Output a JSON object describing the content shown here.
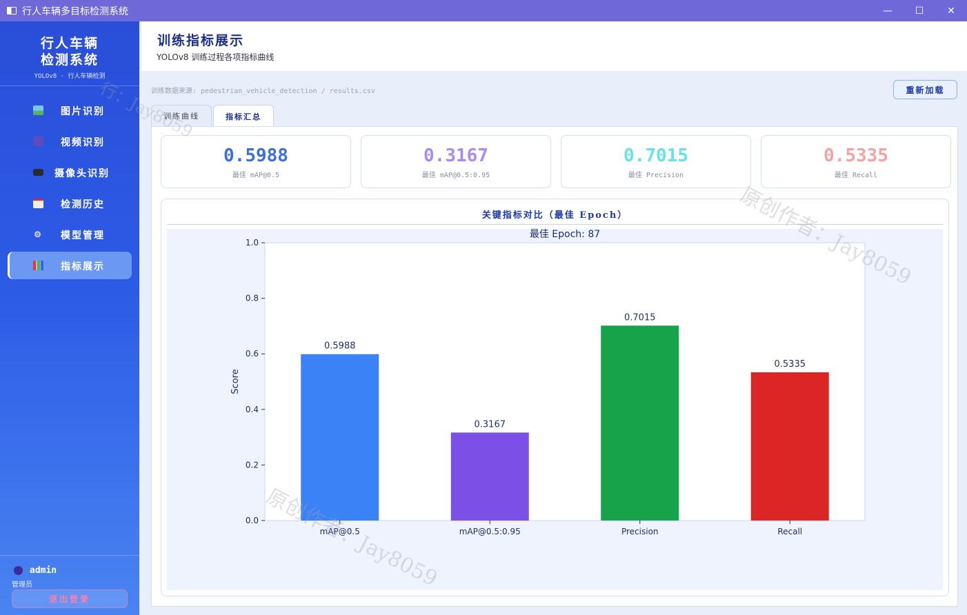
{
  "window": {
    "title": "行人车辆多目标检测系统",
    "minimize": "—",
    "maximize": "☐",
    "close": "✕"
  },
  "sidebar": {
    "brand_line1": "行人车辆",
    "brand_line2": "检测系统",
    "brand_sub": "YOLOv8 · 行人车辆检测",
    "items": [
      {
        "label": "图片识别",
        "icon": "image-icon",
        "active": false
      },
      {
        "label": "视频识别",
        "icon": "video-icon",
        "active": false
      },
      {
        "label": "摄像头识别",
        "icon": "camera-icon",
        "active": false
      },
      {
        "label": "检测历史",
        "icon": "history-icon",
        "active": false
      },
      {
        "label": "模型管理",
        "icon": "gear-icon",
        "active": false
      },
      {
        "label": "指标展示",
        "icon": "bar-chart-icon",
        "active": true
      }
    ],
    "user_name": "admin",
    "user_role": "管理员",
    "logout_label": "退出登录"
  },
  "header": {
    "title": "训练指标展示",
    "subtitle": "YOLOv8 训练过程各项指标曲线"
  },
  "source_text": "训练数据来源: pedestrian_vehicle_detection / results.csv",
  "reload_label": "重新加载",
  "tabs": [
    {
      "label": "训练曲线",
      "active": false
    },
    {
      "label": "指标汇总",
      "active": true
    }
  ],
  "cards": [
    {
      "value": "0.5988",
      "label": "最佳 mAP@0.5",
      "color": "#3b6fe0"
    },
    {
      "value": "0.3167",
      "label": "最佳 mAP@0.5:0.95",
      "color": "#a78bfa"
    },
    {
      "value": "0.7015",
      "label": "最佳 Precision",
      "color": "#67e3e8"
    },
    {
      "value": "0.5335",
      "label": "最佳 Recall",
      "color": "#f4a3a3"
    }
  ],
  "chart_section_title": "关键指标对比（最佳 Epoch）",
  "watermarks": [
    "原创作者：Jay8059",
    "原创作者：Jay8059",
    "行：Jay8059"
  ],
  "chart_data": {
    "type": "bar",
    "title": "最佳 Epoch: 87",
    "xlabel": "",
    "ylabel": "Score",
    "ylim": [
      0,
      1.0
    ],
    "yticks": [
      "0.0",
      "0.2",
      "0.4",
      "0.6",
      "0.8",
      "1.0"
    ],
    "categories": [
      "mAP@0.5",
      "mAP@0.5:0.95",
      "Precision",
      "Recall"
    ],
    "values": [
      0.5988,
      0.3167,
      0.7015,
      0.5335
    ],
    "value_labels": [
      "0.5988",
      "0.3167",
      "0.7015",
      "0.5335"
    ],
    "colors": [
      "#3b82f6",
      "#7c4fe6",
      "#16a34a",
      "#dc2626"
    ],
    "grid": false
  }
}
